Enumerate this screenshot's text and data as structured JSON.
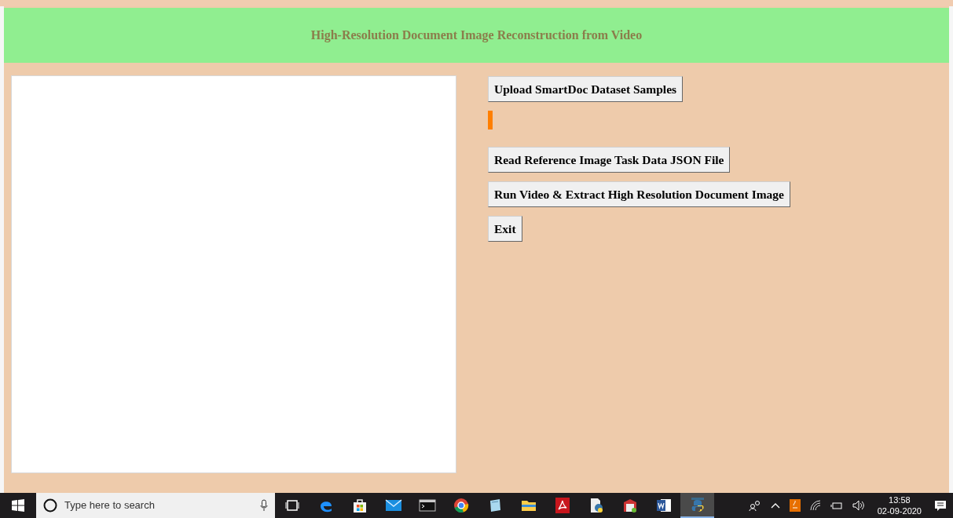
{
  "header": {
    "title": "High-Resolution Document Image Reconstruction from Video"
  },
  "buttons": [
    {
      "label": "Upload SmartDoc Dataset Samples"
    },
    {
      "label": "Read Reference Image Task Data JSON File"
    },
    {
      "label": "Run Video & Extract High Resolution Document Image"
    },
    {
      "label": "Exit"
    }
  ],
  "taskbar": {
    "search": {
      "placeholder": "Type here to search"
    },
    "apps": [
      {
        "kind": "taskview",
        "selected": false
      },
      {
        "kind": "edge",
        "selected": false
      },
      {
        "kind": "store",
        "selected": false
      },
      {
        "kind": "mail",
        "selected": false
      },
      {
        "kind": "terminal",
        "selected": false
      },
      {
        "kind": "chrome",
        "selected": false
      },
      {
        "kind": "notepad",
        "selected": false
      },
      {
        "kind": "folder",
        "selected": false
      },
      {
        "kind": "pdf",
        "selected": false
      },
      {
        "kind": "pyfile",
        "selected": false
      },
      {
        "kind": "archive",
        "selected": false
      },
      {
        "kind": "word",
        "selected": false
      },
      {
        "kind": "python",
        "selected": true
      }
    ],
    "time": "13:58",
    "date": "02-09-2020"
  }
}
